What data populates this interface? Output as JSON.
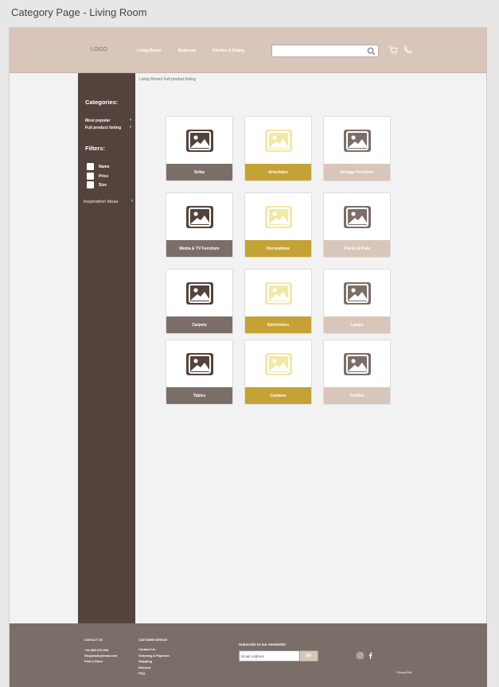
{
  "page_title": "Category Page - Living Room",
  "header": {
    "logo": "LOGO",
    "nav": [
      "Living Room",
      "Bedroom",
      "Kitchen & Dining"
    ],
    "search_placeholder": ""
  },
  "breadcrumb": "Living Room/ Full product listing",
  "sidebar": {
    "categories_heading": "Categories:",
    "category_links": [
      "Most popular",
      "Full product listing"
    ],
    "filters_heading": "Filters:",
    "filters": [
      "Name",
      "Price",
      "Size"
    ],
    "inspiration": "Inspiration Ideas"
  },
  "products": [
    {
      "label": "Sofas",
      "style": "dark"
    },
    {
      "label": "Armchairs",
      "style": "gold"
    },
    {
      "label": "Storage Furniture",
      "style": "grey"
    },
    {
      "label": "Media & TV Furniture",
      "style": "dark"
    },
    {
      "label": "Decorations",
      "style": "gold"
    },
    {
      "label": "Plants & Pots",
      "style": "grey"
    },
    {
      "label": "Carpets",
      "style": "dark"
    },
    {
      "label": "Electronics",
      "style": "gold"
    },
    {
      "label": "Lamps",
      "style": "grey"
    },
    {
      "label": "Tables",
      "style": "dark"
    },
    {
      "label": "Curtains",
      "style": "gold"
    },
    {
      "label": "Textiles",
      "style": "grey"
    }
  ],
  "footer": {
    "contact_heading": "CONTACT US",
    "contact_lines": [
      "+44 555 079 503",
      "Shopmails@mail.com",
      "Find a Store"
    ],
    "customer_heading": "CUSTOMER SERVICE",
    "customer_links": [
      "Contact Us",
      "Ordering & Payment",
      "Shipping",
      "Returns",
      "FAQ"
    ],
    "newsletter_label": "Subscribe to our newsletter",
    "email_placeholder": "Email Address",
    "ok_label": "OK",
    "copyright": "©Home2046"
  },
  "colors": {
    "header_bg": "#d9c6bb",
    "sidebar_bg": "#53433c",
    "footer_bg": "#7b6e69",
    "gold": "#c5a235",
    "grey_taupe": "#7b6e69"
  }
}
